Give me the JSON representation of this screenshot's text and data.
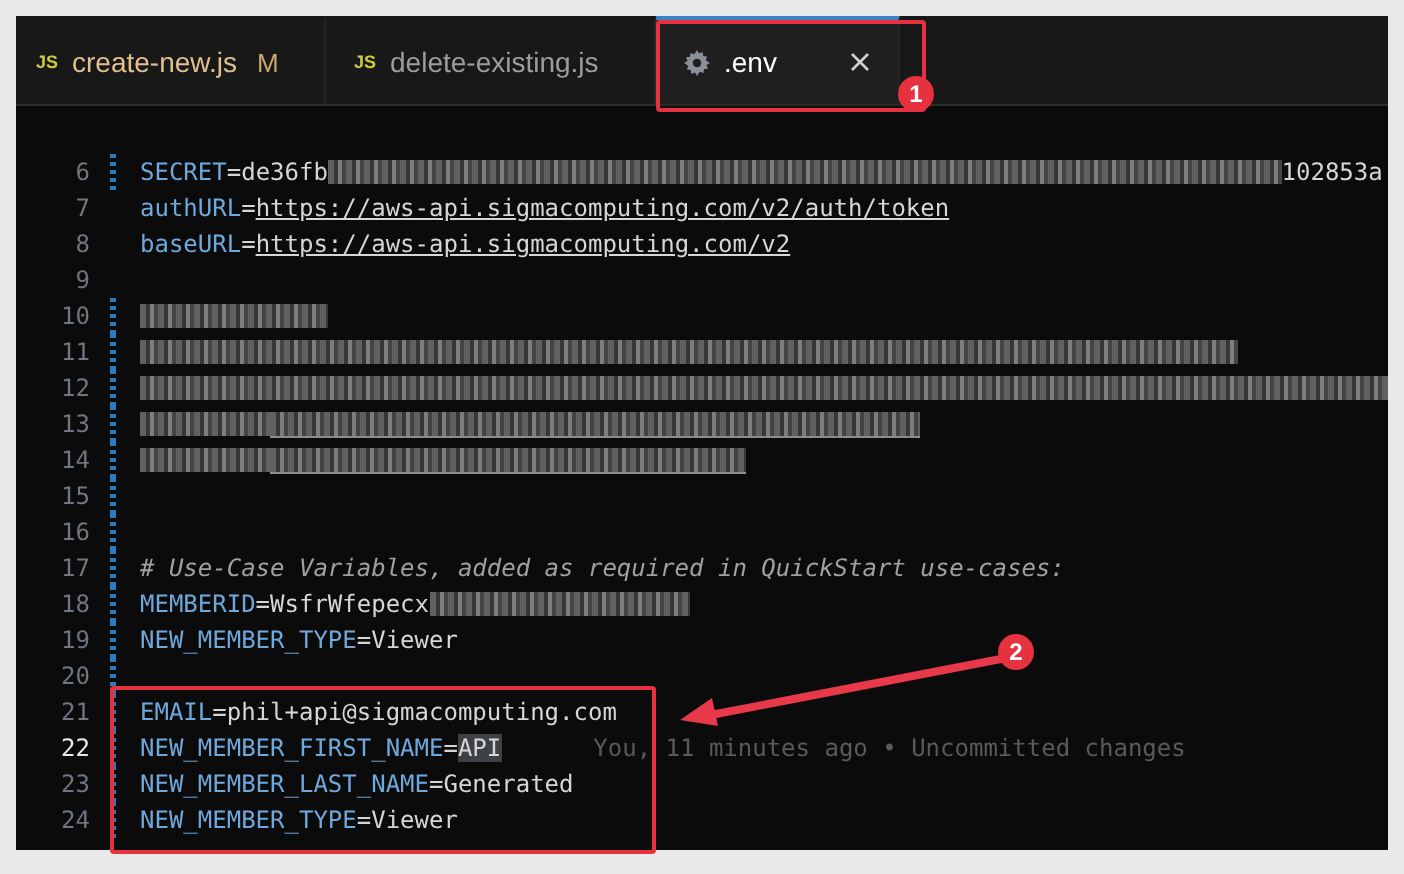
{
  "tabs": [
    {
      "kind": "js",
      "badge": "JS",
      "label": "create-new.js",
      "status": "M",
      "selected": false,
      "modified": true
    },
    {
      "kind": "js",
      "badge": "JS",
      "label": "delete-existing.js",
      "selected": false,
      "modified": false
    },
    {
      "kind": "settings",
      "label": ".env",
      "selected": true,
      "modified": false
    }
  ],
  "lines": [
    {
      "number": "6",
      "changed": true,
      "current": false,
      "segments": [
        {
          "kind": "key",
          "text": "SECRET"
        },
        {
          "kind": "op",
          "text": "="
        },
        {
          "kind": "value",
          "text": "de36fb"
        },
        {
          "kind": "redacted"
        },
        {
          "kind": "value",
          "text": "102853a"
        }
      ]
    },
    {
      "number": "7",
      "changed": false,
      "current": false,
      "segments": [
        {
          "kind": "key",
          "text": "authURL"
        },
        {
          "kind": "op",
          "text": "="
        },
        {
          "kind": "link",
          "text": "https://aws-api.sigmacomputing.com/v2/auth/token"
        }
      ]
    },
    {
      "number": "8",
      "changed": false,
      "current": false,
      "segments": [
        {
          "kind": "key",
          "text": "baseURL"
        },
        {
          "kind": "op",
          "text": "="
        },
        {
          "kind": "link",
          "text": "https://aws-api.sigmacomputing.com/v2"
        }
      ]
    },
    {
      "number": "9",
      "changed": false,
      "current": false
    },
    {
      "number": "10",
      "changed": true,
      "current": false,
      "segments": [
        {
          "kind": "redacted"
        }
      ]
    },
    {
      "number": "11",
      "changed": true,
      "current": false,
      "segments": [
        {
          "kind": "redacted"
        }
      ]
    },
    {
      "number": "12",
      "changed": true,
      "current": false,
      "segments": [
        {
          "kind": "redacted"
        }
      ]
    },
    {
      "number": "13",
      "changed": true,
      "current": false,
      "segments": [
        {
          "kind": "redacted"
        },
        {
          "kind": "redacted-link"
        }
      ]
    },
    {
      "number": "14",
      "changed": true,
      "current": false,
      "segments": [
        {
          "kind": "redacted"
        },
        {
          "kind": "redacted-link"
        }
      ]
    },
    {
      "number": "15",
      "changed": true,
      "current": false
    },
    {
      "number": "16",
      "changed": true,
      "current": false
    },
    {
      "number": "17",
      "changed": true,
      "current": false,
      "segments": [
        {
          "kind": "comment",
          "text": "# Use-Case Variables, added as required in QuickStart use-cases:"
        }
      ]
    },
    {
      "number": "18",
      "changed": true,
      "current": false,
      "segments": [
        {
          "kind": "key",
          "text": "MEMBERID"
        },
        {
          "kind": "op",
          "text": "="
        },
        {
          "kind": "value",
          "text": "WsfrWfepecx"
        },
        {
          "kind": "redacted"
        }
      ]
    },
    {
      "number": "19",
      "changed": true,
      "current": false,
      "segments": [
        {
          "kind": "key",
          "text": "NEW_MEMBER_TYPE"
        },
        {
          "kind": "op",
          "text": "="
        },
        {
          "kind": "value",
          "text": "Viewer"
        }
      ]
    },
    {
      "number": "20",
      "changed": true,
      "current": false
    },
    {
      "number": "21",
      "changed": true,
      "current": false,
      "segments": [
        {
          "kind": "key",
          "text": "EMAIL"
        },
        {
          "kind": "op",
          "text": "="
        },
        {
          "kind": "value",
          "text": "phil+api@sigmacomputing.com"
        }
      ]
    },
    {
      "number": "22",
      "changed": true,
      "current": true,
      "segments": [
        {
          "kind": "key",
          "text": "NEW_MEMBER_FIRST_NAME"
        },
        {
          "kind": "op",
          "text": "="
        },
        {
          "kind": "selection",
          "text": "API"
        },
        {
          "kind": "blame",
          "text": "You, 11 minutes ago • Uncommitted changes"
        }
      ]
    },
    {
      "number": "23",
      "changed": true,
      "current": false,
      "segments": [
        {
          "kind": "key",
          "text": "NEW_MEMBER_LAST_NAME"
        },
        {
          "kind": "op",
          "text": "="
        },
        {
          "kind": "value",
          "text": "Generated"
        }
      ]
    },
    {
      "number": "24",
      "changed": true,
      "current": false,
      "segments": [
        {
          "kind": "key",
          "text": "NEW_MEMBER_TYPE"
        },
        {
          "kind": "op",
          "text": "="
        },
        {
          "kind": "value",
          "text": "Viewer"
        }
      ]
    }
  ],
  "annotations": [
    {
      "label": "1"
    },
    {
      "label": "2"
    }
  ]
}
